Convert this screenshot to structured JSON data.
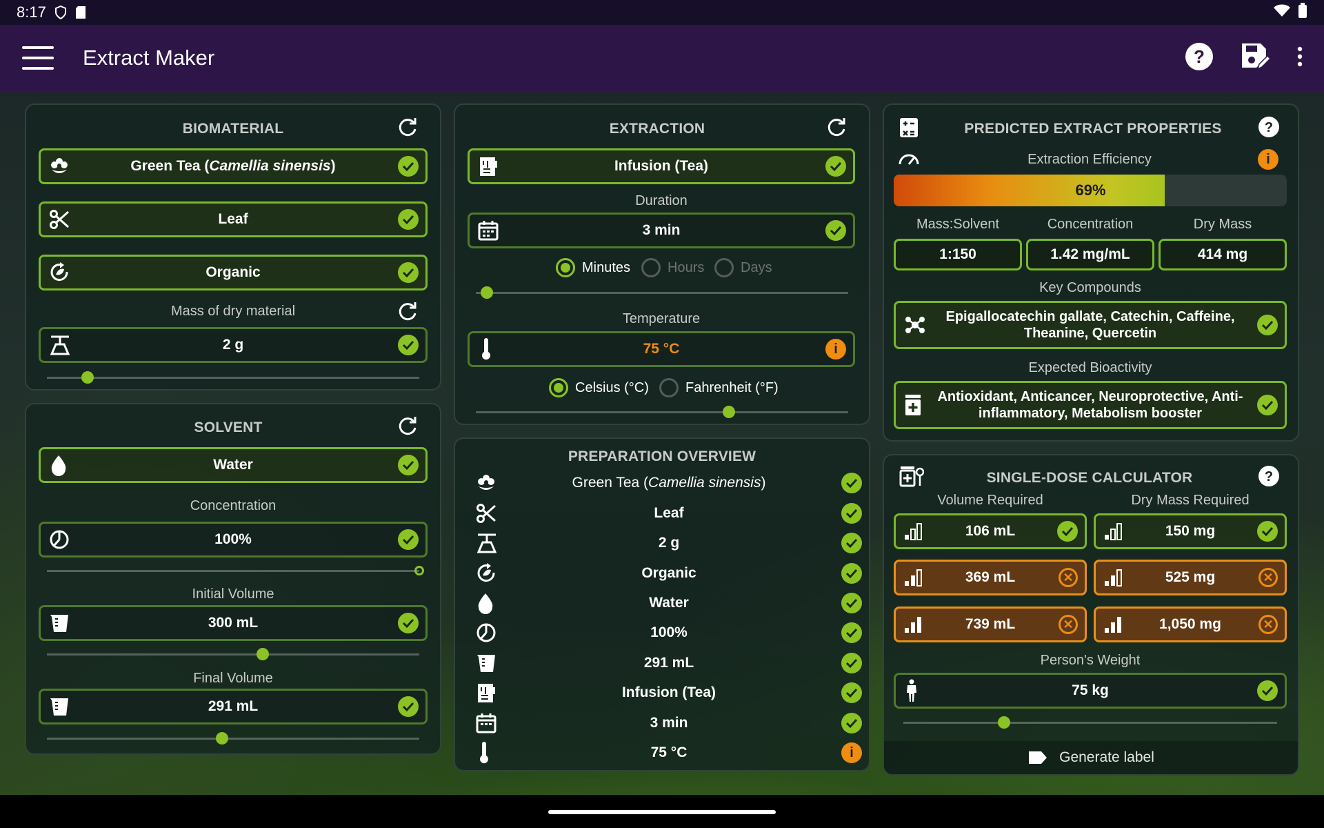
{
  "status": {
    "time": "8:17"
  },
  "appbar": {
    "title": "Extract Maker"
  },
  "biomaterial": {
    "header": "BIOMATERIAL",
    "plant_prefix": "Green Tea (",
    "plant_latin": "Camellia sinensis",
    "plant_suffix": ")",
    "part": "Leaf",
    "cultivation": "Organic",
    "mass_label": "Mass of dry material",
    "mass": "2 g",
    "mass_slider": 0.11
  },
  "solvent": {
    "header": "SOLVENT",
    "name": "Water",
    "conc_label": "Concentration",
    "conc": "100%",
    "conc_slider": 1.0,
    "init_label": "Initial Volume",
    "init": "300 mL",
    "init_slider": 0.58,
    "final_label": "Final Volume",
    "final": "291 mL",
    "final_slider": 0.47
  },
  "extraction": {
    "header": "EXTRACTION",
    "method": "Infusion (Tea)",
    "dur_label": "Duration",
    "duration": "3 min",
    "units": [
      "Minutes",
      "Hours",
      "Days"
    ],
    "dur_slider": 0.03,
    "temp_label": "Temperature",
    "temp": "75 °C",
    "temp_units": [
      "Celsius (°C)",
      "Fahrenheit (°F)"
    ],
    "temp_slider": 0.68
  },
  "overview": {
    "header": "PREPARATION OVERVIEW",
    "plant_prefix": "Green Tea (",
    "plant_latin": "Camellia sinensis",
    "plant_suffix": ")",
    "rows": [
      "Leaf",
      "2 g",
      "Organic",
      "Water",
      "100%",
      "291 mL",
      "Infusion (Tea)",
      "3 min",
      "75 °C"
    ]
  },
  "predicted": {
    "header": "PREDICTED EXTRACT PROPERTIES",
    "eff_label": "Extraction Efficiency",
    "eff_value": "69%",
    "eff_fraction": 0.69,
    "stats_labels": [
      "Mass:Solvent",
      "Concentration",
      "Dry Mass"
    ],
    "stats_values": [
      "1:150",
      "1.42 mg/mL",
      "414 mg"
    ],
    "compounds_label": "Key Compounds",
    "compounds": "Epigallocatechin gallate, Catechin, Caffeine, Theanine, Quercetin",
    "bio_label": "Expected Bioactivity",
    "bio": "Antioxidant, Anticancer, Neuroprotective, Anti-inflammatory, Metabolism booster"
  },
  "dose": {
    "header": "SINGLE-DOSE CALCULATOR",
    "vol_label": "Volume Required",
    "mass_label": "Dry Mass Required",
    "volumes": [
      "106 mL",
      "369 mL",
      "739 mL"
    ],
    "masses": [
      "150 mg",
      "525 mg",
      "1,050 mg"
    ],
    "weight_label": "Person's Weight",
    "weight": "75 kg",
    "weight_slider": 0.27,
    "generate": "Generate label"
  },
  "colors": {
    "accent": "#8bc325",
    "warning": "#f08c10",
    "appbar": "#2d1548"
  }
}
